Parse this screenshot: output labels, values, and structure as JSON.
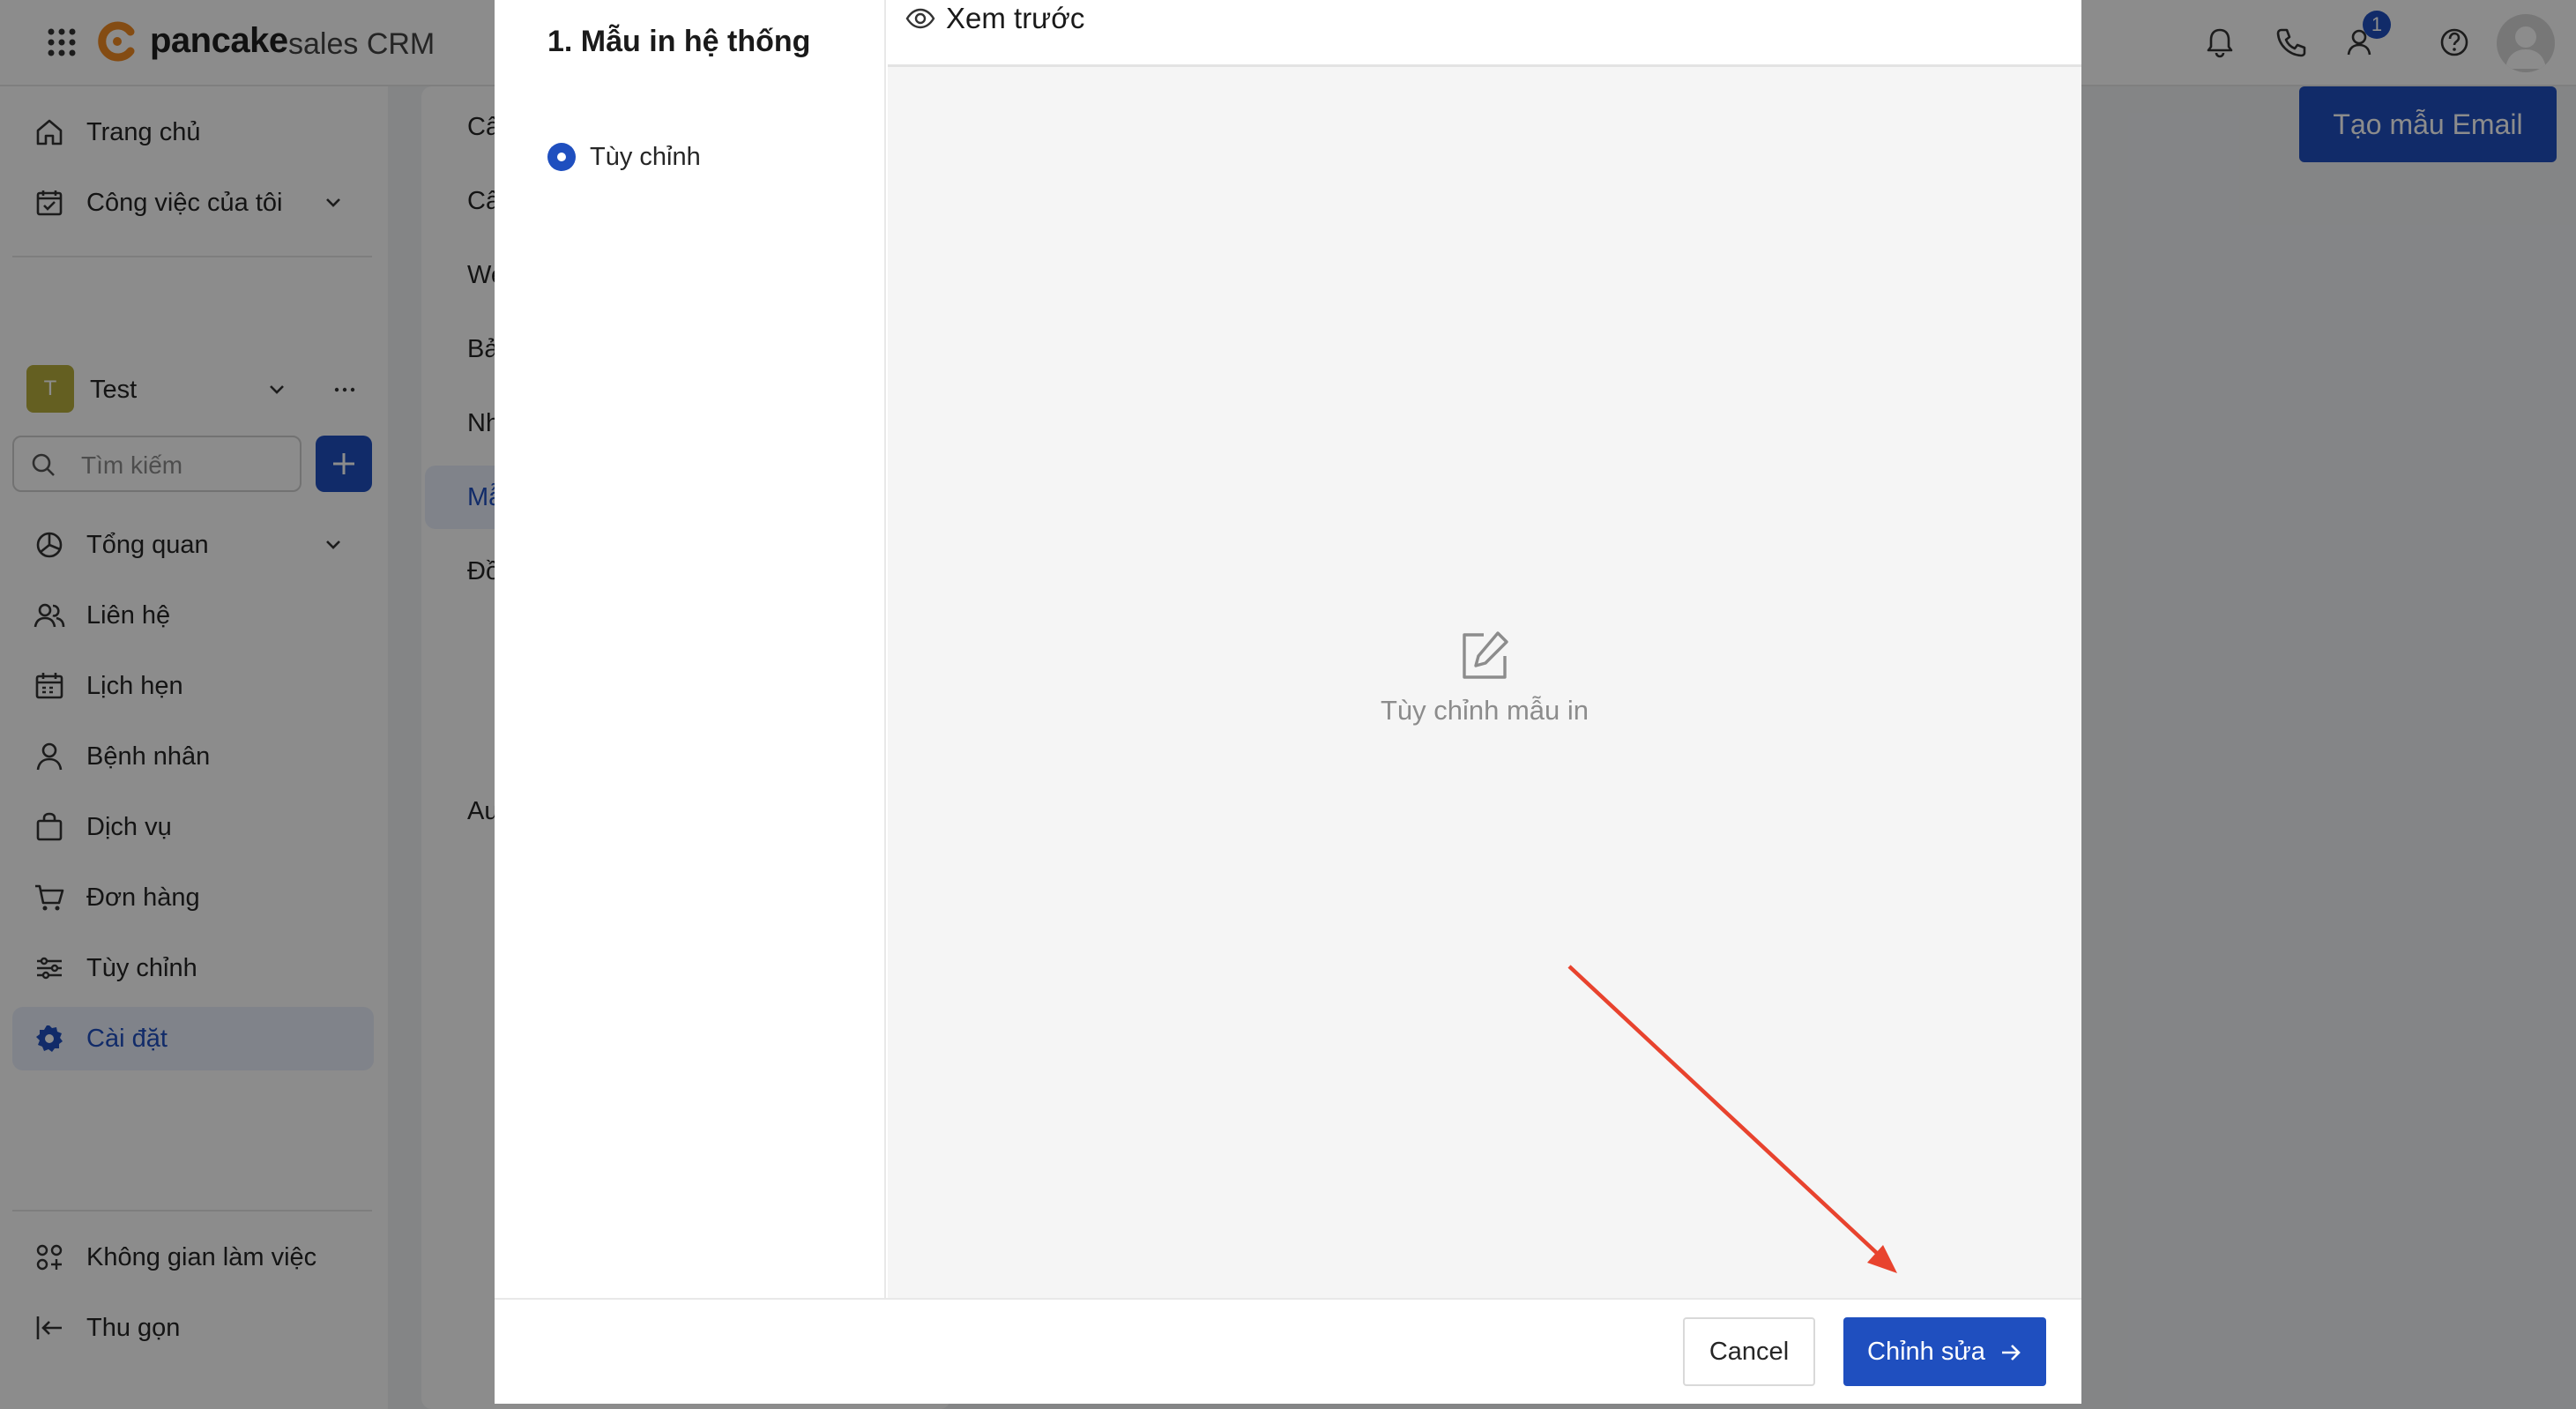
{
  "app": {
    "brand": "pancake",
    "product": "sales CRM"
  },
  "topbar": {
    "notification_count": "1",
    "icons": [
      "bell-icon",
      "phone-icon",
      "contacts-icon",
      "help-icon",
      "avatar"
    ]
  },
  "sidebar": {
    "top_items": [
      {
        "label": "Trang chủ",
        "icon": "home-icon"
      },
      {
        "label": "Công việc của tôi",
        "icon": "calendar-check-icon"
      }
    ],
    "workspace": {
      "initial": "T",
      "name": "Test"
    },
    "search_placeholder": "Tìm kiếm",
    "items": [
      {
        "label": "Tổng quan",
        "icon": "pie-chart-icon"
      },
      {
        "label": "Liên hệ",
        "icon": "users-icon"
      },
      {
        "label": "Lịch hẹn",
        "icon": "calendar-icon"
      },
      {
        "label": "Bệnh nhân",
        "icon": "user-icon"
      },
      {
        "label": "Dịch vụ",
        "icon": "bag-icon"
      },
      {
        "label": "Đơn hàng",
        "icon": "cart-icon"
      },
      {
        "label": "Tùy chỉnh",
        "icon": "sliders-icon"
      },
      {
        "label": "Cài đặt",
        "icon": "gear-icon",
        "active": true
      }
    ],
    "bottom_items": [
      {
        "label": "Không gian làm việc",
        "icon": "workspace-icon"
      },
      {
        "label": "Thu gọn",
        "icon": "collapse-icon"
      }
    ]
  },
  "background": {
    "settings_items": [
      "Câ",
      "Câ",
      "We",
      "Bả",
      "Nh",
      "Mẫ",
      "Đồ",
      "Au"
    ],
    "create_button": "Tạo mẫu Email"
  },
  "modal": {
    "left_title": "1. Mẫu in hệ thống",
    "option_label": "Tùy chỉnh",
    "preview_title": "Xem trước",
    "empty_text": "Tùy chỉnh mẫu in",
    "cancel_label": "Cancel",
    "edit_label": "Chỉnh sửa"
  },
  "colors": {
    "accent": "#1f4fbf",
    "annotation_arrow": "#e8432e"
  }
}
